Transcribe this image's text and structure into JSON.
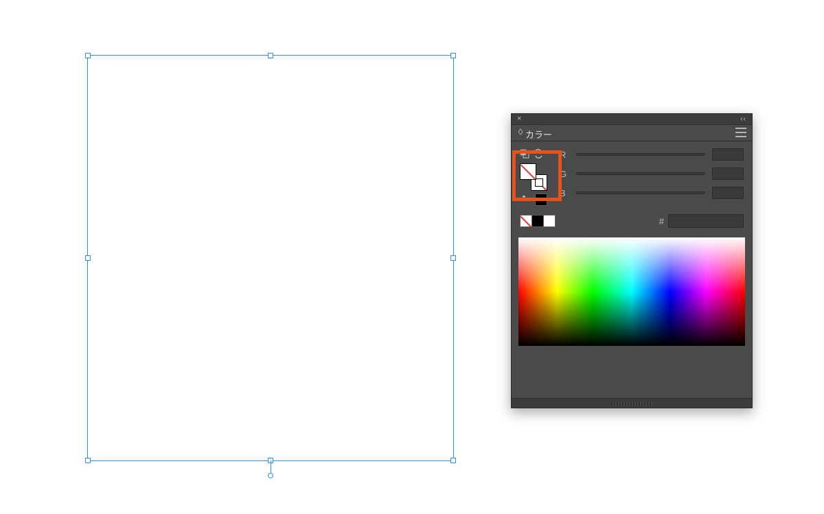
{
  "panel": {
    "title": "カラー",
    "close_tooltip": "×",
    "collapse_marker": "‹‹",
    "channels": {
      "r_label": "R",
      "g_label": "G",
      "b_label": "B",
      "r_value": "",
      "g_value": "",
      "b_value": ""
    },
    "hex": {
      "hash": "#",
      "value": ""
    },
    "preset_swatches": [
      "none",
      "black",
      "white"
    ],
    "fill_color": "none",
    "stroke_color": "none",
    "last_color": "#000000"
  },
  "selection": {
    "handles": [
      "tl",
      "tm",
      "tr",
      "ml",
      "mr",
      "bl",
      "bm",
      "br"
    ]
  },
  "annotation": {
    "highlight_target": "fill-stroke-swatches"
  }
}
